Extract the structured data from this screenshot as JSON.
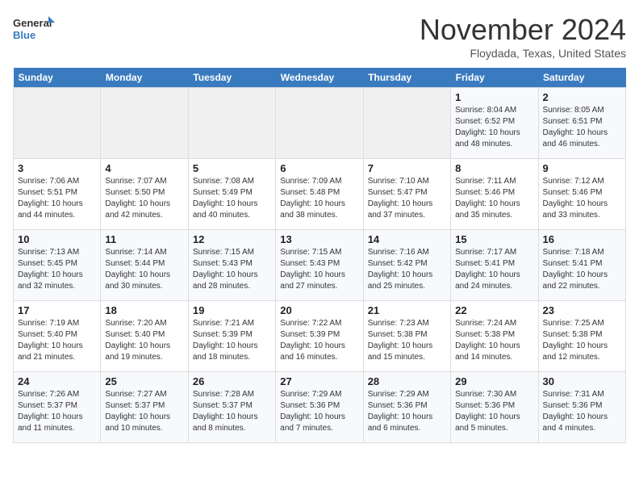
{
  "header": {
    "logo_line1": "General",
    "logo_line2": "Blue",
    "month_title": "November 2024",
    "location": "Floydada, Texas, United States"
  },
  "weekdays": [
    "Sunday",
    "Monday",
    "Tuesday",
    "Wednesday",
    "Thursday",
    "Friday",
    "Saturday"
  ],
  "weeks": [
    [
      {
        "day": "",
        "empty": true
      },
      {
        "day": "",
        "empty": true
      },
      {
        "day": "",
        "empty": true
      },
      {
        "day": "",
        "empty": true
      },
      {
        "day": "",
        "empty": true
      },
      {
        "day": "1",
        "sunrise": "Sunrise: 8:04 AM",
        "sunset": "Sunset: 6:52 PM",
        "daylight": "Daylight: 10 hours and 48 minutes."
      },
      {
        "day": "2",
        "sunrise": "Sunrise: 8:05 AM",
        "sunset": "Sunset: 6:51 PM",
        "daylight": "Daylight: 10 hours and 46 minutes."
      }
    ],
    [
      {
        "day": "3",
        "sunrise": "Sunrise: 7:06 AM",
        "sunset": "Sunset: 5:51 PM",
        "daylight": "Daylight: 10 hours and 44 minutes."
      },
      {
        "day": "4",
        "sunrise": "Sunrise: 7:07 AM",
        "sunset": "Sunset: 5:50 PM",
        "daylight": "Daylight: 10 hours and 42 minutes."
      },
      {
        "day": "5",
        "sunrise": "Sunrise: 7:08 AM",
        "sunset": "Sunset: 5:49 PM",
        "daylight": "Daylight: 10 hours and 40 minutes."
      },
      {
        "day": "6",
        "sunrise": "Sunrise: 7:09 AM",
        "sunset": "Sunset: 5:48 PM",
        "daylight": "Daylight: 10 hours and 38 minutes."
      },
      {
        "day": "7",
        "sunrise": "Sunrise: 7:10 AM",
        "sunset": "Sunset: 5:47 PM",
        "daylight": "Daylight: 10 hours and 37 minutes."
      },
      {
        "day": "8",
        "sunrise": "Sunrise: 7:11 AM",
        "sunset": "Sunset: 5:46 PM",
        "daylight": "Daylight: 10 hours and 35 minutes."
      },
      {
        "day": "9",
        "sunrise": "Sunrise: 7:12 AM",
        "sunset": "Sunset: 5:46 PM",
        "daylight": "Daylight: 10 hours and 33 minutes."
      }
    ],
    [
      {
        "day": "10",
        "sunrise": "Sunrise: 7:13 AM",
        "sunset": "Sunset: 5:45 PM",
        "daylight": "Daylight: 10 hours and 32 minutes."
      },
      {
        "day": "11",
        "sunrise": "Sunrise: 7:14 AM",
        "sunset": "Sunset: 5:44 PM",
        "daylight": "Daylight: 10 hours and 30 minutes."
      },
      {
        "day": "12",
        "sunrise": "Sunrise: 7:15 AM",
        "sunset": "Sunset: 5:43 PM",
        "daylight": "Daylight: 10 hours and 28 minutes."
      },
      {
        "day": "13",
        "sunrise": "Sunrise: 7:15 AM",
        "sunset": "Sunset: 5:43 PM",
        "daylight": "Daylight: 10 hours and 27 minutes."
      },
      {
        "day": "14",
        "sunrise": "Sunrise: 7:16 AM",
        "sunset": "Sunset: 5:42 PM",
        "daylight": "Daylight: 10 hours and 25 minutes."
      },
      {
        "day": "15",
        "sunrise": "Sunrise: 7:17 AM",
        "sunset": "Sunset: 5:41 PM",
        "daylight": "Daylight: 10 hours and 24 minutes."
      },
      {
        "day": "16",
        "sunrise": "Sunrise: 7:18 AM",
        "sunset": "Sunset: 5:41 PM",
        "daylight": "Daylight: 10 hours and 22 minutes."
      }
    ],
    [
      {
        "day": "17",
        "sunrise": "Sunrise: 7:19 AM",
        "sunset": "Sunset: 5:40 PM",
        "daylight": "Daylight: 10 hours and 21 minutes."
      },
      {
        "day": "18",
        "sunrise": "Sunrise: 7:20 AM",
        "sunset": "Sunset: 5:40 PM",
        "daylight": "Daylight: 10 hours and 19 minutes."
      },
      {
        "day": "19",
        "sunrise": "Sunrise: 7:21 AM",
        "sunset": "Sunset: 5:39 PM",
        "daylight": "Daylight: 10 hours and 18 minutes."
      },
      {
        "day": "20",
        "sunrise": "Sunrise: 7:22 AM",
        "sunset": "Sunset: 5:39 PM",
        "daylight": "Daylight: 10 hours and 16 minutes."
      },
      {
        "day": "21",
        "sunrise": "Sunrise: 7:23 AM",
        "sunset": "Sunset: 5:38 PM",
        "daylight": "Daylight: 10 hours and 15 minutes."
      },
      {
        "day": "22",
        "sunrise": "Sunrise: 7:24 AM",
        "sunset": "Sunset: 5:38 PM",
        "daylight": "Daylight: 10 hours and 14 minutes."
      },
      {
        "day": "23",
        "sunrise": "Sunrise: 7:25 AM",
        "sunset": "Sunset: 5:38 PM",
        "daylight": "Daylight: 10 hours and 12 minutes."
      }
    ],
    [
      {
        "day": "24",
        "sunrise": "Sunrise: 7:26 AM",
        "sunset": "Sunset: 5:37 PM",
        "daylight": "Daylight: 10 hours and 11 minutes."
      },
      {
        "day": "25",
        "sunrise": "Sunrise: 7:27 AM",
        "sunset": "Sunset: 5:37 PM",
        "daylight": "Daylight: 10 hours and 10 minutes."
      },
      {
        "day": "26",
        "sunrise": "Sunrise: 7:28 AM",
        "sunset": "Sunset: 5:37 PM",
        "daylight": "Daylight: 10 hours and 8 minutes."
      },
      {
        "day": "27",
        "sunrise": "Sunrise: 7:29 AM",
        "sunset": "Sunset: 5:36 PM",
        "daylight": "Daylight: 10 hours and 7 minutes."
      },
      {
        "day": "28",
        "sunrise": "Sunrise: 7:29 AM",
        "sunset": "Sunset: 5:36 PM",
        "daylight": "Daylight: 10 hours and 6 minutes."
      },
      {
        "day": "29",
        "sunrise": "Sunrise: 7:30 AM",
        "sunset": "Sunset: 5:36 PM",
        "daylight": "Daylight: 10 hours and 5 minutes."
      },
      {
        "day": "30",
        "sunrise": "Sunrise: 7:31 AM",
        "sunset": "Sunset: 5:36 PM",
        "daylight": "Daylight: 10 hours and 4 minutes."
      }
    ]
  ]
}
